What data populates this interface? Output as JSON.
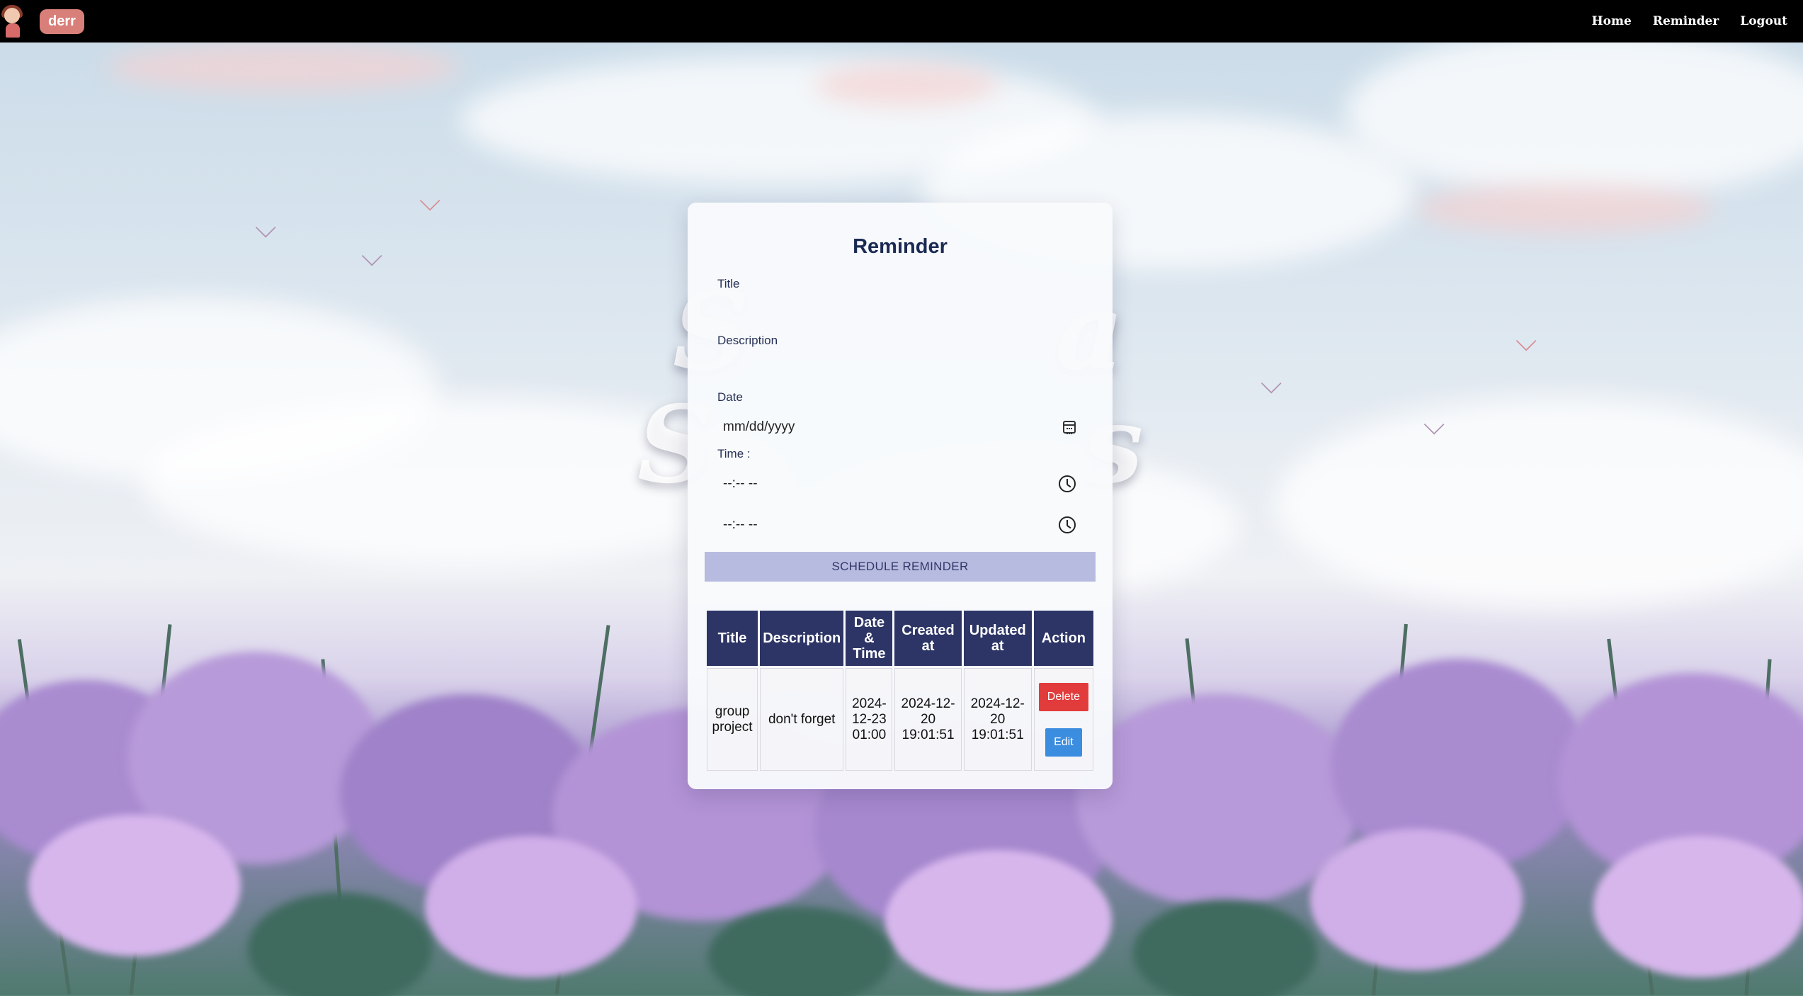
{
  "navbar": {
    "brand": "derr",
    "links": [
      "Home",
      "Reminder",
      "Logout"
    ]
  },
  "card": {
    "title": "Reminder",
    "title_label": "Title",
    "description_label": "Description",
    "date_label": "Date",
    "date_placeholder": "mm/dd/yyyy",
    "time_label": "Time :",
    "time_start_placeholder": "--:-- --",
    "time_end_placeholder": "--:-- --",
    "schedule_button": "SCHEDULE REMINDER"
  },
  "table": {
    "headers": [
      "Title",
      "Description",
      "Date & Time",
      "Created at",
      "Updated at",
      "Action"
    ],
    "rows": [
      {
        "title": "group project",
        "description": "don't forget",
        "datetime": "2024-12-23 01:00",
        "created_at": "2024-12-20 19:01:51",
        "updated_at": "2024-12-20 19:01:51",
        "delete_label": "Delete",
        "edit_label": "Edit"
      }
    ]
  },
  "colors": {
    "navbar": "#000000",
    "brand_badge": "#d97f7a",
    "table_header": "#2d3566",
    "schedule_button": "#b8bbe0",
    "delete_button": "#e23b3b",
    "edit_button": "#3b8de0"
  }
}
